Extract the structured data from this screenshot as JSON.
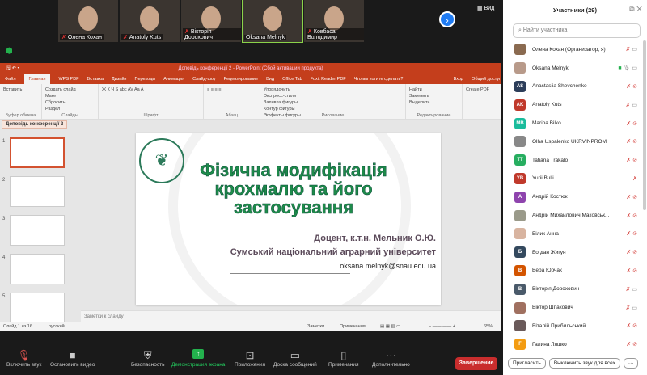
{
  "videos": [
    "Олена Кохан",
    "Anatoly Kuts",
    "Вікторія Дорохович",
    "Oksana Melnyk",
    "Ковбаса Володимир"
  ],
  "view_label": "Вид",
  "ppt": {
    "title": "Доповідь конференції 2 - PowerPoint (Сбой активации продукта)",
    "tabs": [
      "Файл",
      "Главная",
      "WPS PDF",
      "Вставка",
      "Дизайн",
      "Переходы",
      "Анимация",
      "Слайд-шоу",
      "Рецензирование",
      "Вид",
      "Office Tab",
      "Foxit Reader PDF",
      "Что вы хотите сделать?",
      "Вход",
      "Общий доступ"
    ],
    "groups": [
      {
        "label": "Буфер обмена",
        "items": [
          "Вставить"
        ]
      },
      {
        "label": "Слайды",
        "items": [
          "Создать слайд",
          "Макет",
          "Сбросить",
          "Раздел"
        ]
      },
      {
        "label": "Шрифт",
        "items": [
          "Ж К Ч S abc AV Aa A"
        ]
      },
      {
        "label": "Абзац",
        "items": [
          "≡ ≡ ≡ ≡"
        ]
      },
      {
        "label": "Рисование",
        "items": [
          "Упорядочить",
          "Экспресс-стили",
          "Заливка фигуры",
          "Контур фигуры",
          "Эффекты фигуры"
        ]
      },
      {
        "label": "Редактирование",
        "items": [
          "Найти",
          "Заменить",
          "Выделить"
        ]
      },
      {
        "label": "",
        "items": [
          "Create PDF"
        ]
      }
    ],
    "doc_tab": "Доповідь конференції 2",
    "slide": {
      "title_lines": [
        "Фізична модифікація",
        "крохмалю та його",
        "застосування"
      ],
      "author": "Доцент, к.т.н. Мельник О.Ю.",
      "university": "Сумський національний аграрний університет",
      "email": "oksana.melnyk@snau.edu.ua"
    },
    "notes_placeholder": "Заметки к слайду",
    "status": {
      "slide": "Слайд 1 из 16",
      "lang": "русский",
      "notes": "Заметки",
      "comments": "Примечания",
      "zoom": "65%"
    }
  },
  "toolbar": [
    "Включить звук",
    "Остановить видео",
    "Безопасность",
    "Демонстрация экрана",
    "Приложения",
    "Доска сообщений",
    "Примечания",
    "Дополнительно"
  ],
  "end_label": "Завершение",
  "panel": {
    "title": "Участники (29)",
    "search_placeholder": "Найти участника",
    "participants": [
      {
        "name": "Олена Кохан (Организатор, я)",
        "initials": "",
        "color": "#8a6a50",
        "video": true
      },
      {
        "name": "Oksana Melnyk",
        "initials": "",
        "color": "#b89a8a",
        "video": true,
        "unmuted": true
      },
      {
        "name": "Anastasiia Shevchenko",
        "initials": "AS",
        "color": "#2d3e5a",
        "video": false
      },
      {
        "name": "Anatoly Kuts",
        "initials": "AK",
        "color": "#c0392b",
        "video": true
      },
      {
        "name": "Marina Bilko",
        "initials": "MB",
        "color": "#1abc9c",
        "video": false
      },
      {
        "name": "Olha Uspalenko UKRVINPROM",
        "initials": "",
        "color": "#888",
        "video": false
      },
      {
        "name": "Tatiana Trakalo",
        "initials": "TT",
        "color": "#27ae60",
        "video": false
      },
      {
        "name": "Yurii Bulii",
        "initials": "YB",
        "color": "#c0392b",
        "video": null
      },
      {
        "name": "Андрій Костюк",
        "initials": "А",
        "color": "#8e44ad",
        "video": false
      },
      {
        "name": "Андрій Михайлович Маковськ...",
        "initials": "",
        "color": "#9a9a8a",
        "video": false
      },
      {
        "name": "Білик Анна",
        "initials": "",
        "color": "#d8b4a0",
        "video": false
      },
      {
        "name": "Богдан Жигун",
        "initials": "Б",
        "color": "#34495e",
        "video": false
      },
      {
        "name": "Вера Юрчак",
        "initials": "В",
        "color": "#d35400",
        "video": false
      },
      {
        "name": "Вікторія Дорохович",
        "initials": "В",
        "color": "#4a5a6a",
        "video": true
      },
      {
        "name": "Віктор Шпакович",
        "initials": "",
        "color": "#a07060",
        "video": true
      },
      {
        "name": "Віталій Прибильський",
        "initials": "",
        "color": "#6a5a5a",
        "video": false
      },
      {
        "name": "Галина Ляшко",
        "initials": "Г",
        "color": "#f39c12",
        "video": false
      }
    ],
    "invite_label": "Пригласить",
    "mute_all_label": "Выключить звук для всех",
    "more_label": "···"
  }
}
